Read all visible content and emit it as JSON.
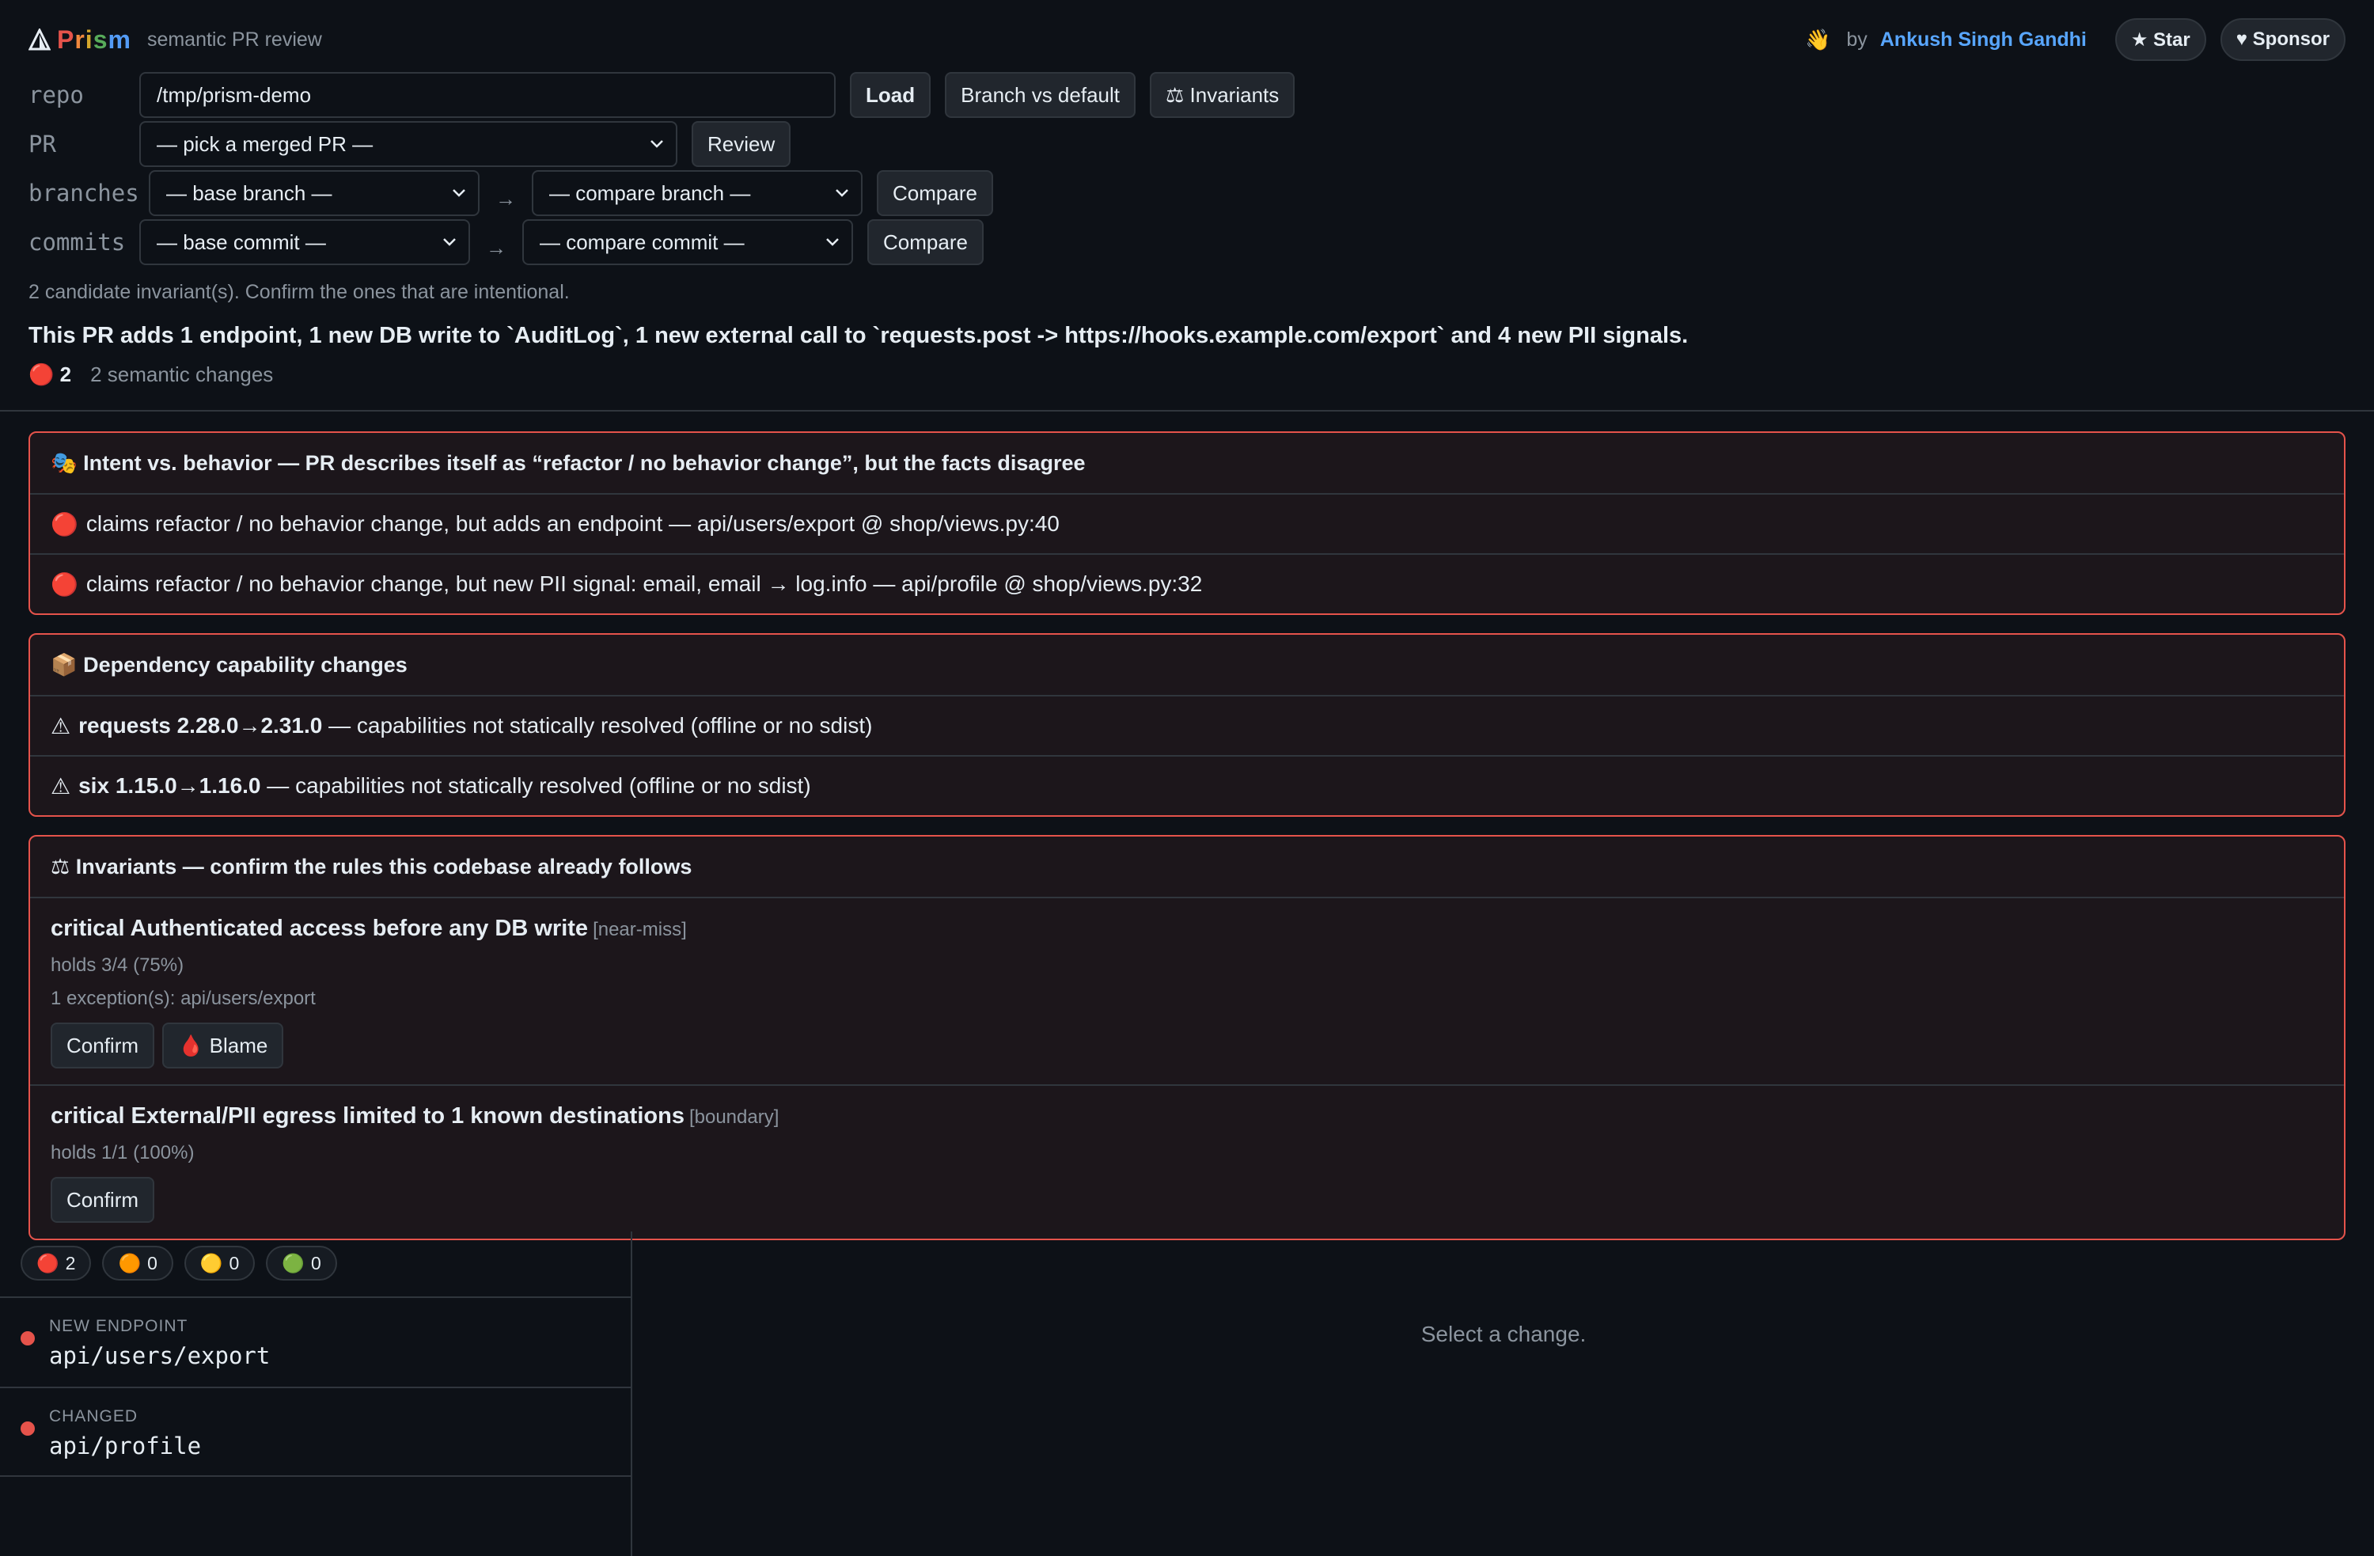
{
  "header": {
    "brand": [
      "P",
      "r",
      "i",
      "s",
      "m"
    ],
    "tagline": "semantic PR review",
    "wave": "👋",
    "by": "by",
    "author": "Ankush Singh Gandhi",
    "star": "★ Star",
    "sponsor": "♥ Sponsor"
  },
  "controls": {
    "repo_label": "repo",
    "repo_value": "/tmp/prism-demo",
    "load": "Load",
    "branch_vs_default": "Branch vs default",
    "invariants": "⚖ Invariants",
    "pr_label": "PR",
    "pr_select": "— pick a merged PR —",
    "review": "Review",
    "branches_label": "branches",
    "base_branch": "— base branch —",
    "compare_branch": "— compare branch —",
    "compare": "Compare",
    "commits_label": "commits",
    "base_commit": "— base commit —",
    "compare_commit": "— compare commit —",
    "arrow": "→"
  },
  "note": "2 candidate invariant(s). Confirm the ones that are intentional.",
  "summary": "This PR adds 1 endpoint, 1 new DB write to `AuditLog`, 1 new external call to `requests.post -> https://hooks.example.com/export` and 4 new PII signals.",
  "counts": {
    "red": "🔴 2",
    "semantic": "2 semantic changes"
  },
  "intent_panel": {
    "title": "🎭 Intent vs. behavior — PR describes itself as “refactor / no behavior change”, but the facts disagree",
    "rows": [
      {
        "icon": "🔴",
        "text": "claims refactor / no behavior change, but adds an endpoint — api/users/export @ shop/views.py:40"
      },
      {
        "icon": "🔴",
        "text": "claims refactor / no behavior change, but new PII signal: email, email → log.info — api/profile @ shop/views.py:32"
      }
    ]
  },
  "deps_panel": {
    "title": "📦 Dependency capability changes",
    "rows": [
      {
        "icon": "⚠",
        "pkg": "requests 2.28.0→2.31.0",
        "text": " — capabilities not statically resolved (offline or no sdist)"
      },
      {
        "icon": "⚠",
        "pkg": "six 1.15.0→1.16.0",
        "text": " — capabilities not statically resolved (offline or no sdist)"
      }
    ]
  },
  "invariants_panel": {
    "title": "⚖ Invariants — confirm the rules this codebase already follows",
    "items": [
      {
        "title": "critical Authenticated access before any DB write",
        "tag": "[near-miss]",
        "holds": "holds 3/4 (75%)",
        "exceptions": "1 exception(s): api/users/export",
        "confirm": "Confirm",
        "blame": "🩸 Blame"
      },
      {
        "title": "critical External/PII egress limited to 1 known destinations",
        "tag": "[boundary]",
        "holds": "holds 1/1 (100%)",
        "confirm": "Confirm"
      }
    ]
  },
  "filters": [
    {
      "dot": "🔴",
      "count": "2"
    },
    {
      "dot": "🟠",
      "count": "0"
    },
    {
      "dot": "🟡",
      "count": "0"
    },
    {
      "dot": "🟢",
      "count": "0"
    }
  ],
  "changes": [
    {
      "kind": "NEW ENDPOINT",
      "path": "api/users/export"
    },
    {
      "kind": "CHANGED",
      "path": "api/profile"
    }
  ],
  "empty": "Select a change.",
  "colors": {
    "accent_red": "#e5534b",
    "link": "#58a6ff",
    "bg": "#0d1117"
  }
}
